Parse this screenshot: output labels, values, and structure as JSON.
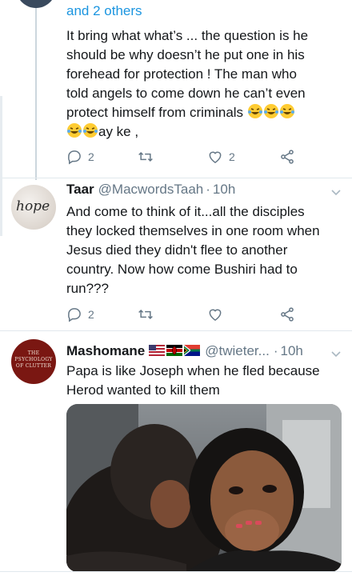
{
  "tweet1": {
    "replying_suffix": "and 2 others",
    "text_line1": "It bring what what’s ... the question is he",
    "text_line2": "should be why doesn’t he put one in his",
    "text_line3": "forehead for protection ! The man who",
    "text_line4": "told angels to come down he can’t even",
    "text_line5": "protect himself from criminals",
    "text_line6_suffix": "ay ke ,",
    "reply_count": "2",
    "like_count": "2"
  },
  "tweet2": {
    "name": "Taar",
    "handle": "@MacwordsTaah",
    "separator": "·",
    "time": "10h",
    "avatar_text": "hope",
    "text_line1": "And come to think of it...all the disciples",
    "text_line2": "they locked themselves in one room when",
    "text_line3": "Jesus died they didn't flee to another",
    "text_line4": "country. Now how come Bushiri had to",
    "text_line5": "run???",
    "reply_count": "2"
  },
  "tweet3": {
    "name": "Mashomane",
    "handle": "@twieter...",
    "separator": "·",
    "time": "10h",
    "avatar_text_line1": "THE",
    "avatar_text_line2": "PSYCHOLOGY",
    "avatar_text_line3": "OF CLUTTER",
    "text_line1": "Papa is like Joseph when he fled because",
    "text_line2": "Herod wanted to kill them"
  },
  "colors": {
    "accent": "#1b95e0",
    "secondary_text": "#657786",
    "divider": "#e1e8ed"
  },
  "icons": [
    "reply-icon",
    "retweet-icon",
    "like-icon",
    "share-icon",
    "chevron-down-icon",
    "laughing-emoji-icon",
    "flag-us-icon",
    "flag-kenya-icon",
    "flag-south-africa-icon"
  ]
}
